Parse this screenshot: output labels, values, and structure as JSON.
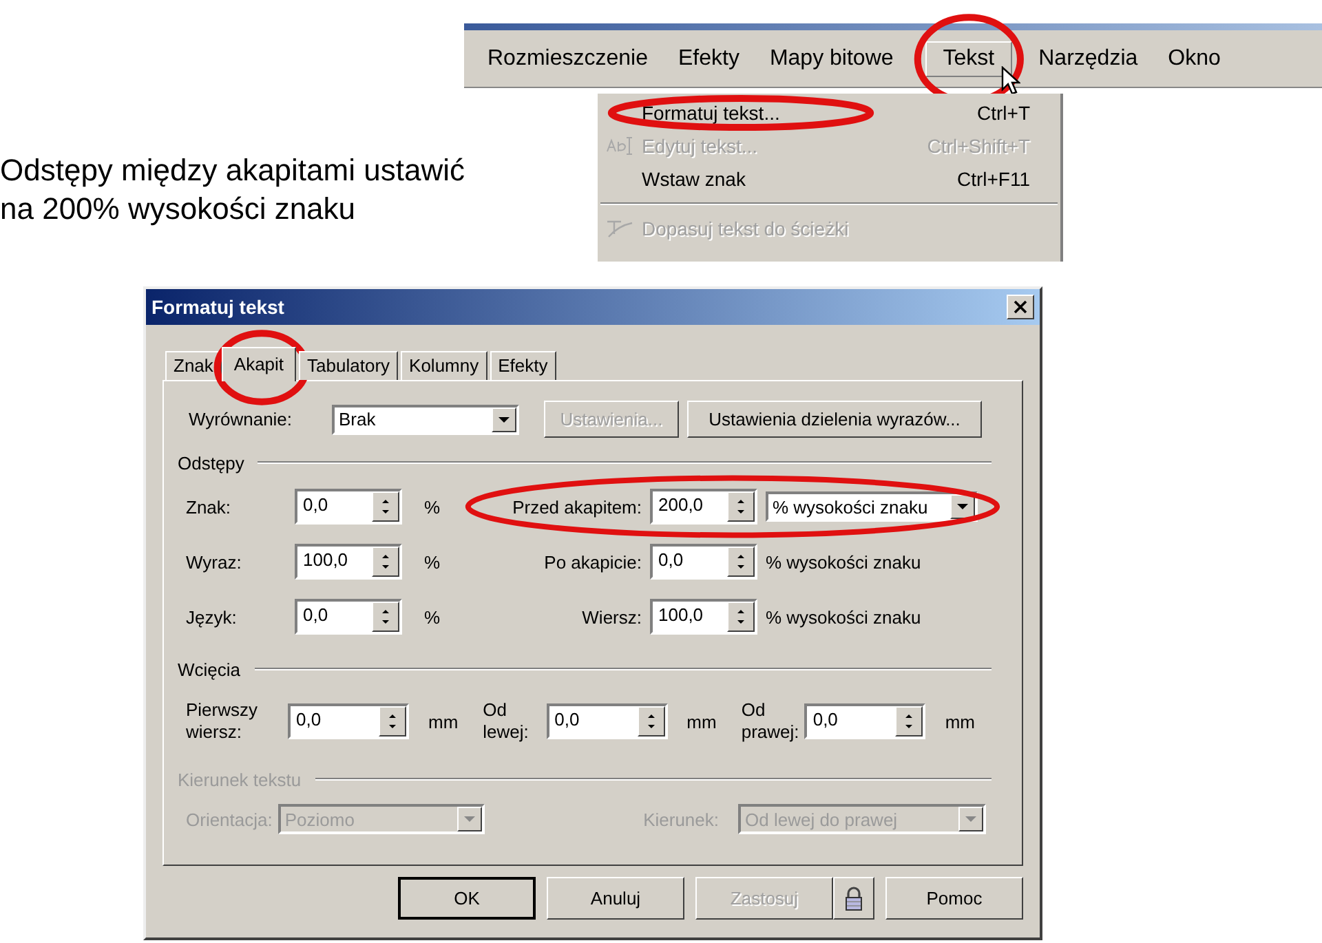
{
  "caption": "Odstępy między akapitami ustawić na 200% wysokości znaku",
  "menu_bar": {
    "items": [
      {
        "label": "Rozmieszczenie",
        "selected": false,
        "circled": false
      },
      {
        "label": "Efekty",
        "selected": false,
        "circled": false
      },
      {
        "label": "Mapy bitowe",
        "selected": false,
        "circled": false
      },
      {
        "label": "Tekst",
        "selected": true,
        "circled": true
      },
      {
        "label": "Narzędzia",
        "selected": false,
        "circled": false
      },
      {
        "label": "Okno",
        "selected": false,
        "circled": false
      }
    ]
  },
  "menu": {
    "items": [
      {
        "kind": "item",
        "label": "Formatuj tekst...",
        "shortcut": "Ctrl+T",
        "disabled": false,
        "circled": true
      },
      {
        "kind": "item",
        "label": "Edytuj tekst...",
        "shortcut": "Ctrl+Shift+T",
        "disabled": true,
        "circled": false
      },
      {
        "kind": "item",
        "label": "Wstaw znak",
        "shortcut": "Ctrl+F11",
        "disabled": false,
        "circled": false
      },
      {
        "kind": "separator"
      },
      {
        "kind": "item",
        "label": "Dopasuj tekst do ścieżki",
        "disabled": true,
        "circled": false
      }
    ]
  },
  "dialog": {
    "title": "Formatuj tekst",
    "tabs": [
      {
        "label": "Znak",
        "selected": false,
        "circled": false
      },
      {
        "label": "Akapit",
        "selected": true,
        "circled": true
      },
      {
        "label": "Tabulatory",
        "selected": false,
        "circled": false
      },
      {
        "label": "Kolumny",
        "selected": false,
        "circled": false
      },
      {
        "label": "Efekty",
        "selected": false,
        "circled": false
      }
    ],
    "alignment": {
      "label": "Wyrównanie:",
      "value": "Brak",
      "settings_button": {
        "label": "Ustawienia...",
        "disabled": true
      },
      "hyphenation_button": {
        "label": "Ustawienia dzielenia wyrazów...",
        "disabled": false
      }
    },
    "spacing": {
      "title": "Odstępy",
      "rows": [
        {
          "left": {
            "label": "Znak:",
            "value": "0,0",
            "unit": "%"
          },
          "right": {
            "label": "Przed akapitem:",
            "value": "200,0",
            "unit": "% wysokości znaku",
            "kind": "dropdown",
            "circled": true
          }
        },
        {
          "left": {
            "label": "Wyraz:",
            "value": "100,0",
            "unit": "%"
          },
          "right": {
            "label": "Po akapicie:",
            "value": "0,0",
            "unit": "% wysokości znaku",
            "kind": "text",
            "circled": false
          }
        },
        {
          "left": {
            "label": "Język:",
            "value": "0,0",
            "unit": "%"
          },
          "right": {
            "label": "Wiersz:",
            "value": "100,0",
            "unit": "% wysokości znaku",
            "kind": "text",
            "circled": false
          }
        }
      ]
    },
    "indents": {
      "title": "Wcięcia",
      "fields": [
        {
          "label_1": "Pierwszy",
          "label_2": "wiersz:",
          "value": "0,0",
          "unit": "mm"
        },
        {
          "label_1": "Od",
          "label_2": "lewej:",
          "value": "0,0",
          "unit": "mm"
        },
        {
          "label_1": "Od",
          "label_2": "prawej:",
          "value": "0,0",
          "unit": "mm"
        }
      ]
    },
    "direction": {
      "title": "Kierunek tekstu",
      "disabled": true,
      "fields": [
        {
          "label": "Orientacja:",
          "value": "Poziomo"
        },
        {
          "label": "Kierunek:",
          "value": "Od lewej do prawej"
        }
      ]
    },
    "buttons": [
      {
        "kind": "default",
        "label": "OK",
        "disabled": false
      },
      {
        "kind": "normal",
        "label": "Anuluj",
        "disabled": false
      },
      {
        "kind": "normal",
        "label": "Zastosuj",
        "disabled": true
      },
      {
        "kind": "lock"
      },
      {
        "kind": "normal",
        "label": "Pomoc",
        "disabled": false
      }
    ]
  }
}
